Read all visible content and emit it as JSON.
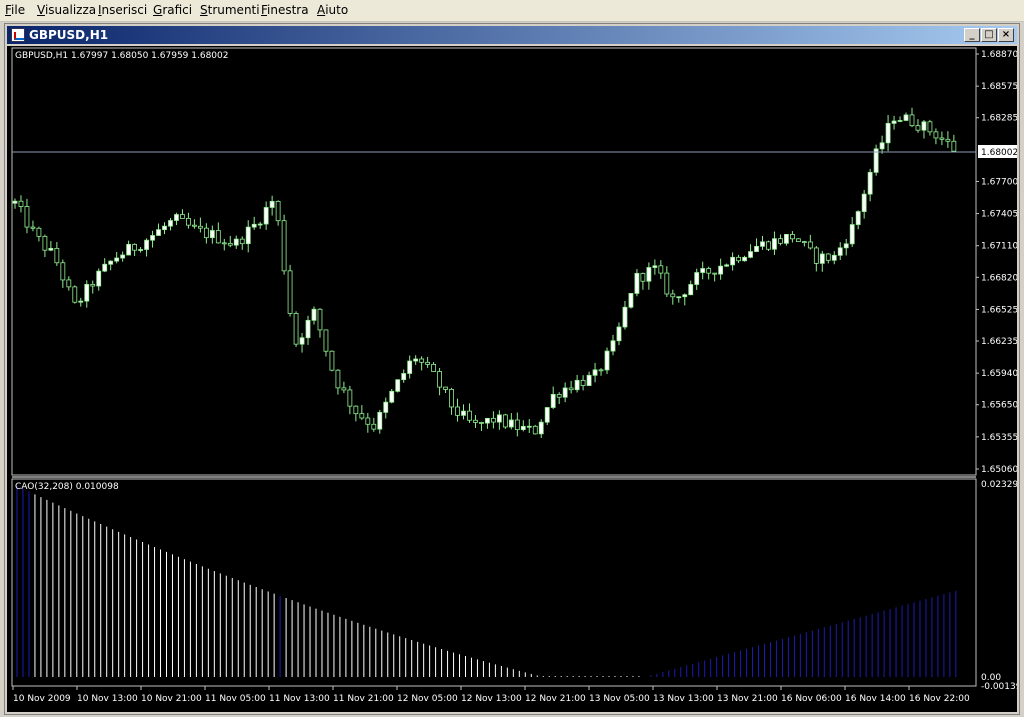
{
  "menu": [
    "File",
    "Visualizza",
    "Inserisci",
    "Grafici",
    "Strumenti",
    "Finestra",
    "Aiuto"
  ],
  "window": {
    "title": "GBPUSD,H1",
    "btn_min": "_",
    "btn_max": "□",
    "btn_close": "×"
  },
  "chart": {
    "info": "GBPUSD,H1  1.67997 1.68050 1.67959 1.68002",
    "current_price": "1.68002",
    "price_axis": [
      "1.68870",
      "1.68575",
      "1.68285",
      "1.67700",
      "1.67405",
      "1.67110",
      "1.66820",
      "1.66525",
      "1.66235",
      "1.65940",
      "1.65650",
      "1.65355",
      "1.65060"
    ],
    "time_axis": [
      "10 Nov 2009",
      "10 Nov 13:00",
      "10 Nov 21:00",
      "11 Nov 05:00",
      "11 Nov 13:00",
      "11 Nov 21:00",
      "12 Nov 05:00",
      "12 Nov 13:00",
      "12 Nov 21:00",
      "13 Nov 05:00",
      "13 Nov 13:00",
      "13 Nov 21:00",
      "16 Nov 06:00",
      "16 Nov 14:00",
      "16 Nov 22:00"
    ]
  },
  "indicator": {
    "label": "CAO(32,208) 0.010098",
    "axis_top": "0.023291",
    "axis_zero": "0.00",
    "axis_bottom": "-0.00139"
  },
  "colors": {
    "bull": "#ffffff",
    "bear": "#000000",
    "wick": "#90ee90",
    "bid_line": "#8c9db8",
    "osc_white": "#ffffff",
    "osc_blue": "#1c1cb4"
  },
  "chart_data": {
    "type": "candlestick",
    "symbol": "GBPUSD",
    "timeframe": "H1",
    "ohlc_last": [
      1.67997,
      1.6805,
      1.67959,
      1.68002
    ],
    "ylim": [
      1.6506,
      1.6887
    ],
    "x_ticks": [
      "10 Nov 2009",
      "10 Nov 13:00",
      "10 Nov 21:00",
      "11 Nov 05:00",
      "11 Nov 13:00",
      "11 Nov 21:00",
      "12 Nov 05:00",
      "12 Nov 13:00",
      "12 Nov 21:00",
      "13 Nov 05:00",
      "13 Nov 13:00",
      "13 Nov 21:00",
      "16 Nov 06:00",
      "16 Nov 14:00",
      "16 Nov 22:00"
    ],
    "close_path": [
      1.675,
      1.672,
      1.67,
      1.6655,
      1.668,
      1.67,
      1.671,
      1.6722,
      1.6735,
      1.6725,
      1.672,
      1.6712,
      1.673,
      1.6755,
      1.662,
      1.665,
      1.659,
      1.656,
      1.6545,
      1.658,
      1.661,
      1.659,
      1.656,
      1.6545,
      1.6552,
      1.6545,
      1.654,
      1.6575,
      1.6585,
      1.659,
      1.662,
      1.668,
      1.669,
      1.666,
      1.668,
      1.669,
      1.67,
      1.671,
      1.6715,
      1.672,
      1.67,
      1.67,
      1.673,
      1.679,
      1.683,
      1.6825,
      1.6815,
      1.68
    ]
  }
}
